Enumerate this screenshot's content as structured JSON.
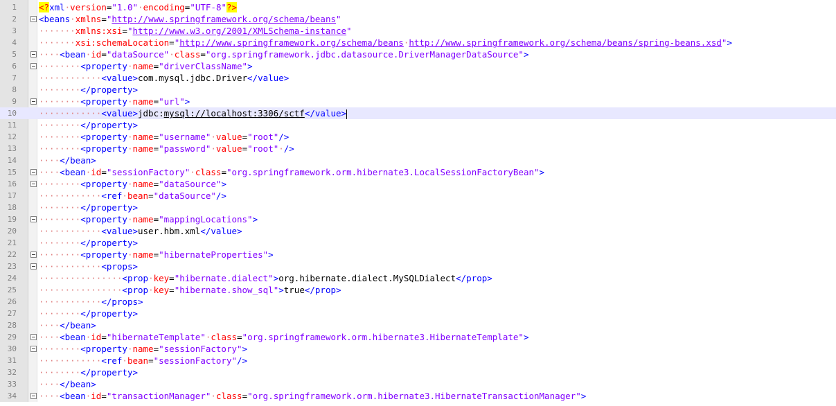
{
  "editor": {
    "lines": [
      {
        "n": "1",
        "fold": "",
        "segs": [
          {
            "t": "<?",
            "c": "pi"
          },
          {
            "t": "xml",
            "c": "tag"
          },
          {
            "t": "·",
            "c": "ws"
          },
          {
            "t": "version",
            "c": "attr"
          },
          {
            "t": "=",
            "c": "txt"
          },
          {
            "t": "\"1.0\"",
            "c": "val"
          },
          {
            "t": "·",
            "c": "ws"
          },
          {
            "t": "encoding",
            "c": "attr"
          },
          {
            "t": "=",
            "c": "txt"
          },
          {
            "t": "\"UTF-8\"",
            "c": "val"
          },
          {
            "t": "?>",
            "c": "pi"
          }
        ]
      },
      {
        "n": "2",
        "fold": "minus",
        "segs": [
          {
            "t": "<beans",
            "c": "tag"
          },
          {
            "t": "·",
            "c": "ws"
          },
          {
            "t": "xmlns",
            "c": "attr"
          },
          {
            "t": "=",
            "c": "txt"
          },
          {
            "t": "\"",
            "c": "val"
          },
          {
            "t": "http://www.springframework.org/schema/beans",
            "c": "url"
          },
          {
            "t": "\"",
            "c": "val"
          }
        ]
      },
      {
        "n": "3",
        "fold": "",
        "segs": [
          {
            "t": "·······",
            "c": "ws"
          },
          {
            "t": "xmlns:xsi",
            "c": "attr"
          },
          {
            "t": "=",
            "c": "txt"
          },
          {
            "t": "\"",
            "c": "val"
          },
          {
            "t": "http://www.w3.org/2001/XMLSchema-instance",
            "c": "url"
          },
          {
            "t": "\"",
            "c": "val"
          }
        ]
      },
      {
        "n": "4",
        "fold": "",
        "segs": [
          {
            "t": "·······",
            "c": "ws"
          },
          {
            "t": "xsi:schemaLocation",
            "c": "attr"
          },
          {
            "t": "=",
            "c": "txt"
          },
          {
            "t": "\"",
            "c": "val"
          },
          {
            "t": "http://www.springframework.org/schema/beans",
            "c": "url"
          },
          {
            "t": "·",
            "c": "ws"
          },
          {
            "t": "http://www.springframework.org/schema/beans/spring-beans.xsd",
            "c": "url"
          },
          {
            "t": "\"",
            "c": "val"
          },
          {
            "t": ">",
            "c": "tag"
          }
        ]
      },
      {
        "n": "5",
        "fold": "minus",
        "segs": [
          {
            "t": "····",
            "c": "ws"
          },
          {
            "t": "<bean",
            "c": "tag"
          },
          {
            "t": "·",
            "c": "ws"
          },
          {
            "t": "id",
            "c": "attr"
          },
          {
            "t": "=",
            "c": "txt"
          },
          {
            "t": "\"dataSource\"",
            "c": "val"
          },
          {
            "t": "·",
            "c": "ws"
          },
          {
            "t": "class",
            "c": "attr"
          },
          {
            "t": "=",
            "c": "txt"
          },
          {
            "t": "\"org.springframework.jdbc.datasource.DriverManagerDataSource\"",
            "c": "val"
          },
          {
            "t": ">",
            "c": "tag"
          }
        ]
      },
      {
        "n": "6",
        "fold": "minus",
        "segs": [
          {
            "t": "········",
            "c": "ws"
          },
          {
            "t": "<property",
            "c": "tag"
          },
          {
            "t": "·",
            "c": "ws"
          },
          {
            "t": "name",
            "c": "attr"
          },
          {
            "t": "=",
            "c": "txt"
          },
          {
            "t": "\"driverClassName\"",
            "c": "val"
          },
          {
            "t": ">",
            "c": "tag"
          }
        ]
      },
      {
        "n": "7",
        "fold": "",
        "segs": [
          {
            "t": "············",
            "c": "ws"
          },
          {
            "t": "<value>",
            "c": "tag"
          },
          {
            "t": "com.mysql.jdbc.Driver",
            "c": "txt"
          },
          {
            "t": "</value>",
            "c": "tag"
          }
        ]
      },
      {
        "n": "8",
        "fold": "",
        "segs": [
          {
            "t": "········",
            "c": "ws"
          },
          {
            "t": "</property>",
            "c": "tag"
          }
        ]
      },
      {
        "n": "9",
        "fold": "minus",
        "segs": [
          {
            "t": "········",
            "c": "ws"
          },
          {
            "t": "<property",
            "c": "tag"
          },
          {
            "t": "·",
            "c": "ws"
          },
          {
            "t": "name",
            "c": "attr"
          },
          {
            "t": "=",
            "c": "txt"
          },
          {
            "t": "\"url\"",
            "c": "val"
          },
          {
            "t": ">",
            "c": "tag"
          }
        ]
      },
      {
        "n": "10",
        "fold": "",
        "current": true,
        "segs": [
          {
            "t": "············",
            "c": "ws"
          },
          {
            "t": "<value>",
            "c": "tag"
          },
          {
            "t": "jdbc:",
            "c": "txt"
          },
          {
            "t": "mysql://localhost:3306/sctf",
            "c": "txt ulink"
          },
          {
            "t": "</value>",
            "c": "tag"
          }
        ]
      },
      {
        "n": "11",
        "fold": "",
        "segs": [
          {
            "t": "········",
            "c": "ws"
          },
          {
            "t": "</property>",
            "c": "tag"
          }
        ]
      },
      {
        "n": "12",
        "fold": "",
        "segs": [
          {
            "t": "········",
            "c": "ws"
          },
          {
            "t": "<property",
            "c": "tag"
          },
          {
            "t": "·",
            "c": "ws"
          },
          {
            "t": "name",
            "c": "attr"
          },
          {
            "t": "=",
            "c": "txt"
          },
          {
            "t": "\"username\"",
            "c": "val"
          },
          {
            "t": "·",
            "c": "ws"
          },
          {
            "t": "value",
            "c": "attr"
          },
          {
            "t": "=",
            "c": "txt"
          },
          {
            "t": "\"root\"",
            "c": "val"
          },
          {
            "t": "/>",
            "c": "tag"
          }
        ]
      },
      {
        "n": "13",
        "fold": "",
        "segs": [
          {
            "t": "········",
            "c": "ws"
          },
          {
            "t": "<property",
            "c": "tag"
          },
          {
            "t": "·",
            "c": "ws"
          },
          {
            "t": "name",
            "c": "attr"
          },
          {
            "t": "=",
            "c": "txt"
          },
          {
            "t": "\"password\"",
            "c": "val"
          },
          {
            "t": "·",
            "c": "ws"
          },
          {
            "t": "value",
            "c": "attr"
          },
          {
            "t": "=",
            "c": "txt"
          },
          {
            "t": "\"root\"",
            "c": "val"
          },
          {
            "t": "·",
            "c": "ws"
          },
          {
            "t": "/>",
            "c": "tag"
          }
        ]
      },
      {
        "n": "14",
        "fold": "",
        "segs": [
          {
            "t": "····",
            "c": "ws"
          },
          {
            "t": "</bean>",
            "c": "tag"
          }
        ]
      },
      {
        "n": "15",
        "fold": "minus",
        "segs": [
          {
            "t": "····",
            "c": "ws"
          },
          {
            "t": "<bean",
            "c": "tag"
          },
          {
            "t": "·",
            "c": "ws"
          },
          {
            "t": "id",
            "c": "attr"
          },
          {
            "t": "=",
            "c": "txt"
          },
          {
            "t": "\"sessionFactory\"",
            "c": "val"
          },
          {
            "t": "·",
            "c": "ws"
          },
          {
            "t": "class",
            "c": "attr"
          },
          {
            "t": "=",
            "c": "txt"
          },
          {
            "t": "\"org.springframework.orm.hibernate3.LocalSessionFactoryBean\"",
            "c": "val"
          },
          {
            "t": ">",
            "c": "tag"
          }
        ]
      },
      {
        "n": "16",
        "fold": "minus",
        "segs": [
          {
            "t": "········",
            "c": "ws"
          },
          {
            "t": "<property",
            "c": "tag"
          },
          {
            "t": "·",
            "c": "ws"
          },
          {
            "t": "name",
            "c": "attr"
          },
          {
            "t": "=",
            "c": "txt"
          },
          {
            "t": "\"dataSource\"",
            "c": "val"
          },
          {
            "t": ">",
            "c": "tag"
          }
        ]
      },
      {
        "n": "17",
        "fold": "",
        "segs": [
          {
            "t": "············",
            "c": "ws"
          },
          {
            "t": "<ref",
            "c": "tag"
          },
          {
            "t": "·",
            "c": "ws"
          },
          {
            "t": "bean",
            "c": "attr"
          },
          {
            "t": "=",
            "c": "txt"
          },
          {
            "t": "\"dataSource\"",
            "c": "val"
          },
          {
            "t": "/>",
            "c": "tag"
          }
        ]
      },
      {
        "n": "18",
        "fold": "",
        "segs": [
          {
            "t": "········",
            "c": "ws"
          },
          {
            "t": "</property>",
            "c": "tag"
          }
        ]
      },
      {
        "n": "19",
        "fold": "minus",
        "segs": [
          {
            "t": "········",
            "c": "ws"
          },
          {
            "t": "<property",
            "c": "tag"
          },
          {
            "t": "·",
            "c": "ws"
          },
          {
            "t": "name",
            "c": "attr"
          },
          {
            "t": "=",
            "c": "txt"
          },
          {
            "t": "\"mappingLocations\"",
            "c": "val"
          },
          {
            "t": ">",
            "c": "tag"
          }
        ]
      },
      {
        "n": "20",
        "fold": "",
        "segs": [
          {
            "t": "············",
            "c": "ws"
          },
          {
            "t": "<value>",
            "c": "tag"
          },
          {
            "t": "user.hbm.xml",
            "c": "txt"
          },
          {
            "t": "</value>",
            "c": "tag"
          }
        ]
      },
      {
        "n": "21",
        "fold": "",
        "segs": [
          {
            "t": "········",
            "c": "ws"
          },
          {
            "t": "</property>",
            "c": "tag"
          }
        ]
      },
      {
        "n": "22",
        "fold": "minus",
        "segs": [
          {
            "t": "········",
            "c": "ws"
          },
          {
            "t": "<property",
            "c": "tag"
          },
          {
            "t": "·",
            "c": "ws"
          },
          {
            "t": "name",
            "c": "attr"
          },
          {
            "t": "=",
            "c": "txt"
          },
          {
            "t": "\"hibernateProperties\"",
            "c": "val"
          },
          {
            "t": ">",
            "c": "tag"
          }
        ]
      },
      {
        "n": "23",
        "fold": "minus",
        "segs": [
          {
            "t": "············",
            "c": "ws"
          },
          {
            "t": "<props>",
            "c": "tag"
          }
        ]
      },
      {
        "n": "24",
        "fold": "",
        "segs": [
          {
            "t": "················",
            "c": "ws"
          },
          {
            "t": "<prop",
            "c": "tag"
          },
          {
            "t": "·",
            "c": "ws"
          },
          {
            "t": "key",
            "c": "attr"
          },
          {
            "t": "=",
            "c": "txt"
          },
          {
            "t": "\"hibernate.dialect\"",
            "c": "val"
          },
          {
            "t": ">",
            "c": "tag"
          },
          {
            "t": "org.hibernate.dialect.MySQLDialect",
            "c": "txt"
          },
          {
            "t": "</prop>",
            "c": "tag"
          }
        ]
      },
      {
        "n": "25",
        "fold": "",
        "segs": [
          {
            "t": "················",
            "c": "ws"
          },
          {
            "t": "<prop",
            "c": "tag"
          },
          {
            "t": "·",
            "c": "ws"
          },
          {
            "t": "key",
            "c": "attr"
          },
          {
            "t": "=",
            "c": "txt"
          },
          {
            "t": "\"hibernate.show_sql\"",
            "c": "val"
          },
          {
            "t": ">",
            "c": "tag"
          },
          {
            "t": "true",
            "c": "txt"
          },
          {
            "t": "</prop>",
            "c": "tag"
          }
        ]
      },
      {
        "n": "26",
        "fold": "",
        "segs": [
          {
            "t": "············",
            "c": "ws"
          },
          {
            "t": "</props>",
            "c": "tag"
          }
        ]
      },
      {
        "n": "27",
        "fold": "",
        "segs": [
          {
            "t": "········",
            "c": "ws"
          },
          {
            "t": "</property>",
            "c": "tag"
          }
        ]
      },
      {
        "n": "28",
        "fold": "",
        "segs": [
          {
            "t": "····",
            "c": "ws"
          },
          {
            "t": "</bean>",
            "c": "tag"
          }
        ]
      },
      {
        "n": "29",
        "fold": "minus",
        "segs": [
          {
            "t": "····",
            "c": "ws"
          },
          {
            "t": "<bean",
            "c": "tag"
          },
          {
            "t": "·",
            "c": "ws"
          },
          {
            "t": "id",
            "c": "attr"
          },
          {
            "t": "=",
            "c": "txt"
          },
          {
            "t": "\"hibernateTemplate\"",
            "c": "val"
          },
          {
            "t": "·",
            "c": "ws"
          },
          {
            "t": "class",
            "c": "attr"
          },
          {
            "t": "=",
            "c": "txt"
          },
          {
            "t": "\"org.springframework.orm.hibernate3.HibernateTemplate\"",
            "c": "val"
          },
          {
            "t": ">",
            "c": "tag"
          }
        ]
      },
      {
        "n": "30",
        "fold": "minus",
        "segs": [
          {
            "t": "········",
            "c": "ws"
          },
          {
            "t": "<property",
            "c": "tag"
          },
          {
            "t": "·",
            "c": "ws"
          },
          {
            "t": "name",
            "c": "attr"
          },
          {
            "t": "=",
            "c": "txt"
          },
          {
            "t": "\"sessionFactory\"",
            "c": "val"
          },
          {
            "t": ">",
            "c": "tag"
          }
        ]
      },
      {
        "n": "31",
        "fold": "",
        "segs": [
          {
            "t": "············",
            "c": "ws"
          },
          {
            "t": "<ref",
            "c": "tag"
          },
          {
            "t": "·",
            "c": "ws"
          },
          {
            "t": "bean",
            "c": "attr"
          },
          {
            "t": "=",
            "c": "txt"
          },
          {
            "t": "\"sessionFactory\"",
            "c": "val"
          },
          {
            "t": "/>",
            "c": "tag"
          }
        ]
      },
      {
        "n": "32",
        "fold": "",
        "segs": [
          {
            "t": "········",
            "c": "ws"
          },
          {
            "t": "</property>",
            "c": "tag"
          }
        ]
      },
      {
        "n": "33",
        "fold": "",
        "segs": [
          {
            "t": "····",
            "c": "ws"
          },
          {
            "t": "</bean>",
            "c": "tag"
          }
        ]
      },
      {
        "n": "34",
        "fold": "minus",
        "segs": [
          {
            "t": "····",
            "c": "ws"
          },
          {
            "t": "<bean",
            "c": "tag"
          },
          {
            "t": "·",
            "c": "ws"
          },
          {
            "t": "id",
            "c": "attr"
          },
          {
            "t": "=",
            "c": "txt"
          },
          {
            "t": "\"transactionManager\"",
            "c": "val"
          },
          {
            "t": "·",
            "c": "ws"
          },
          {
            "t": "class",
            "c": "attr"
          },
          {
            "t": "=",
            "c": "txt"
          },
          {
            "t": "\"org.springframework.orm.hibernate3.HibernateTransactionManager\"",
            "c": "val"
          },
          {
            "t": ">",
            "c": "tag"
          }
        ]
      }
    ],
    "colors": {
      "tag": "#0000ff",
      "attribute": "#ff0000",
      "value": "#8000ff",
      "whitespace": "#e08080",
      "current_line": "#e8e8ff",
      "gutter": "#e4e4e4",
      "pi_highlight": "#ffff00"
    },
    "icons": {
      "fold_open": "minus-box-icon"
    }
  }
}
